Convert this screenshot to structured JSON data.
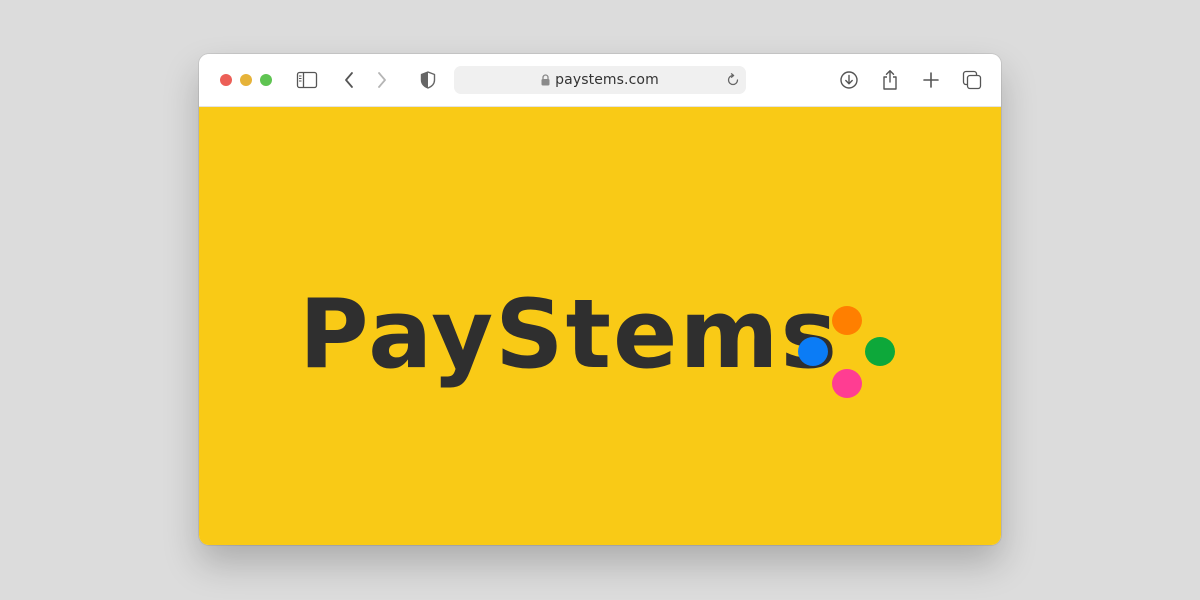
{
  "browser": {
    "url": "paystems.com",
    "traffic_lights": {
      "close": "#ec5f57",
      "minimize": "#e6b339",
      "maximize": "#5fc452"
    },
    "icons": {
      "sidebar": "sidebar-icon",
      "back": "chevron-left-icon",
      "forward": "chevron-right-icon",
      "privacy": "shield-icon",
      "lock": "lock-icon",
      "reload": "reload-icon",
      "download": "download-icon",
      "share": "share-icon",
      "new_tab": "plus-icon",
      "tabs": "tab-overview-icon"
    }
  },
  "page": {
    "background_color": "#f9ca16",
    "logo_text": "PayStems",
    "logo_text_color": "#2f2f2f",
    "dot_colors": {
      "top": "#ff7f00",
      "left": "#0b7cf6",
      "right": "#0da83a",
      "bottom": "#ff3d92"
    }
  }
}
